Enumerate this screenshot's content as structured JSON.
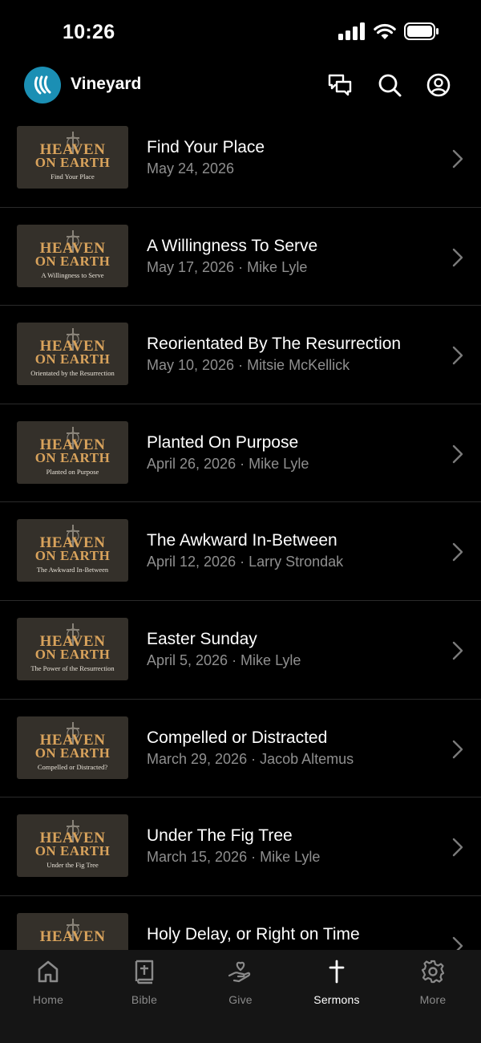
{
  "status_bar": {
    "time": "10:26"
  },
  "header": {
    "app_name": "Vineyard"
  },
  "sermons": [
    {
      "title": "Find Your Place",
      "meta": "May 24, 2026",
      "thumb_line1": "HEAVEN",
      "thumb_line2": "ON EARTH",
      "thumb_subtitle": "Find Your Place"
    },
    {
      "title": "A Willingness To Serve",
      "meta": "May 17, 2026 · Mike Lyle",
      "thumb_line1": "HEAVEN",
      "thumb_line2": "ON EARTH",
      "thumb_subtitle": "A Willingness to Serve"
    },
    {
      "title": "Reorientated By The Resurrection",
      "meta": "May 10, 2026 · Mitsie McKellick",
      "thumb_line1": "HEAVEN",
      "thumb_line2": "ON EARTH",
      "thumb_subtitle": "Orientated by the Resurrection"
    },
    {
      "title": "Planted On Purpose",
      "meta": "April 26, 2026 · Mike Lyle",
      "thumb_line1": "HEAVEN",
      "thumb_line2": "ON EARTH",
      "thumb_subtitle": "Planted on Purpose"
    },
    {
      "title": "The Awkward In-Between",
      "meta": "April 12, 2026 · Larry Strondak",
      "thumb_line1": "HEAVEN",
      "thumb_line2": "ON EARTH",
      "thumb_subtitle": "The Awkward In-Between"
    },
    {
      "title": "Easter Sunday",
      "meta": "April 5, 2026 · Mike Lyle",
      "thumb_line1": "HEAVEN",
      "thumb_line2": "ON EARTH",
      "thumb_subtitle": "The Power of the Resurrection"
    },
    {
      "title": "Compelled or Distracted",
      "meta": "March 29, 2026 · Jacob Altemus",
      "thumb_line1": "HEAVEN",
      "thumb_line2": "ON EARTH",
      "thumb_subtitle": "Compelled or Distracted?"
    },
    {
      "title": "Under The Fig Tree",
      "meta": "March 15, 2026 · Mike Lyle",
      "thumb_line1": "HEAVEN",
      "thumb_line2": "ON EARTH",
      "thumb_subtitle": "Under the Fig Tree"
    },
    {
      "title": "Holy Delay, or Right on Time",
      "meta": "",
      "thumb_line1": "HEAVEN",
      "thumb_line2": "",
      "thumb_subtitle": ""
    }
  ],
  "tabs": [
    {
      "label": "Home",
      "icon": "home-icon"
    },
    {
      "label": "Bible",
      "icon": "bible-icon"
    },
    {
      "label": "Give",
      "icon": "give-icon"
    },
    {
      "label": "Sermons",
      "icon": "cross-icon",
      "active": true
    },
    {
      "label": "More",
      "icon": "gear-icon"
    }
  ],
  "colors": {
    "background": "#000000",
    "accent": "#1b8fb4",
    "thumb_title": "#d9a35c",
    "meta_text": "#8f8f8f",
    "tab_bar": "#151515"
  }
}
